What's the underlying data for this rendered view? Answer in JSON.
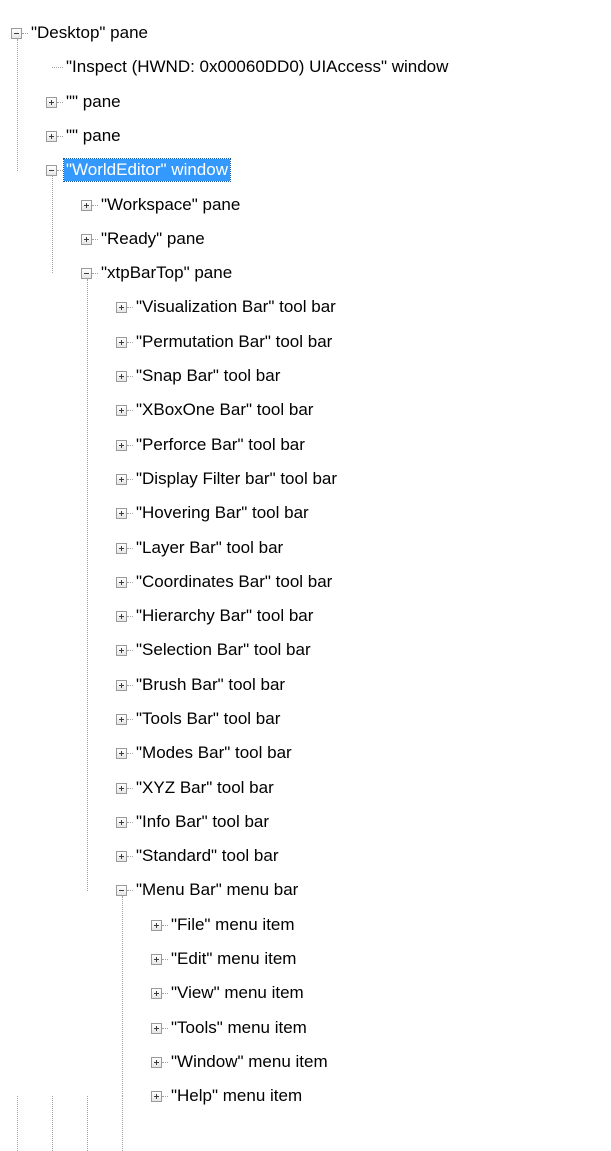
{
  "tree": {
    "nodes": [
      {
        "label": "\"Desktop\" pane",
        "level": 0,
        "state": "expanded"
      },
      {
        "label": "\"Inspect  (HWND: 0x00060DD0) UIAccess\" window",
        "level": 1,
        "state": "leaf"
      },
      {
        "label": "\"\" pane",
        "level": 1,
        "state": "collapsed"
      },
      {
        "label": "\"\" pane",
        "level": 1,
        "state": "collapsed"
      },
      {
        "label": "\"WorldEditor\" window",
        "level": 1,
        "state": "expanded",
        "selected": true
      },
      {
        "label": "\"Workspace\" pane",
        "level": 2,
        "state": "collapsed"
      },
      {
        "label": "\"Ready\" pane",
        "level": 2,
        "state": "collapsed"
      },
      {
        "label": "\"xtpBarTop\" pane",
        "level": 2,
        "state": "expanded"
      },
      {
        "label": "\"Visualization Bar\" tool bar",
        "level": 3,
        "state": "collapsed"
      },
      {
        "label": "\"Permutation Bar\" tool bar",
        "level": 3,
        "state": "collapsed"
      },
      {
        "label": "\"Snap Bar\" tool bar",
        "level": 3,
        "state": "collapsed"
      },
      {
        "label": "\"XBoxOne Bar\" tool bar",
        "level": 3,
        "state": "collapsed"
      },
      {
        "label": "\"Perforce Bar\" tool bar",
        "level": 3,
        "state": "collapsed"
      },
      {
        "label": "\"Display Filter bar\" tool bar",
        "level": 3,
        "state": "collapsed"
      },
      {
        "label": "\"Hovering Bar\" tool bar",
        "level": 3,
        "state": "collapsed"
      },
      {
        "label": "\"Layer Bar\" tool bar",
        "level": 3,
        "state": "collapsed"
      },
      {
        "label": "\"Coordinates Bar\" tool bar",
        "level": 3,
        "state": "collapsed"
      },
      {
        "label": "\"Hierarchy Bar\" tool bar",
        "level": 3,
        "state": "collapsed"
      },
      {
        "label": "\"Selection Bar\" tool bar",
        "level": 3,
        "state": "collapsed"
      },
      {
        "label": "\"Brush Bar\" tool bar",
        "level": 3,
        "state": "collapsed"
      },
      {
        "label": "\"Tools Bar\" tool bar",
        "level": 3,
        "state": "collapsed"
      },
      {
        "label": "\"Modes Bar\" tool bar",
        "level": 3,
        "state": "collapsed"
      },
      {
        "label": "\"XYZ Bar\" tool bar",
        "level": 3,
        "state": "collapsed"
      },
      {
        "label": "\"Info Bar\" tool bar",
        "level": 3,
        "state": "collapsed"
      },
      {
        "label": "\"Standard\" tool bar",
        "level": 3,
        "state": "collapsed"
      },
      {
        "label": "\"Menu Bar\" menu bar",
        "level": 3,
        "state": "expanded"
      },
      {
        "label": "\"File\" menu item",
        "level": 4,
        "state": "collapsed"
      },
      {
        "label": "\"Edit\" menu item",
        "level": 4,
        "state": "collapsed"
      },
      {
        "label": "\"View\" menu item",
        "level": 4,
        "state": "collapsed"
      },
      {
        "label": "\"Tools\" menu item",
        "level": 4,
        "state": "collapsed"
      },
      {
        "label": "\"Window\" menu item",
        "level": 4,
        "state": "collapsed"
      },
      {
        "label": "\"Help\" menu item",
        "level": 4,
        "state": "collapsed"
      }
    ]
  },
  "colors": {
    "selection": "#3399ff",
    "selection_text": "#ffffff",
    "tree_lines": "#a0a0a0"
  }
}
